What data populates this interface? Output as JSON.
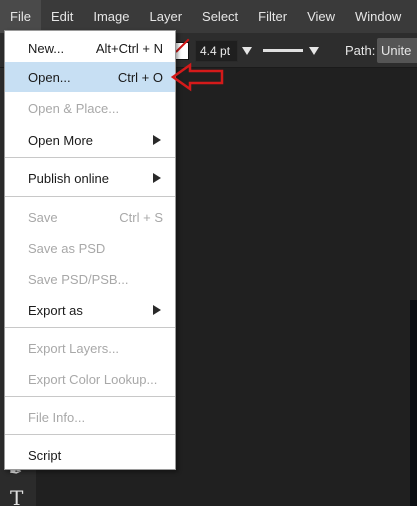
{
  "menubar": {
    "items": [
      "File",
      "Edit",
      "Image",
      "Layer",
      "Select",
      "Filter",
      "View",
      "Window"
    ]
  },
  "options": {
    "stroke_size": "4.4 pt",
    "path_label": "Path:",
    "path_value": "Unite"
  },
  "file_menu": {
    "new_label": "New...",
    "new_shortcut": "Alt+Ctrl + N",
    "open_label": "Open...",
    "open_shortcut": "Ctrl + O",
    "open_place_label": "Open & Place...",
    "open_more_label": "Open More",
    "publish_label": "Publish online",
    "save_label": "Save",
    "save_shortcut": "Ctrl + S",
    "save_psd_label": "Save as PSD",
    "save_psb_label": "Save PSD/PSB...",
    "export_as_label": "Export as",
    "export_layers_label": "Export Layers...",
    "export_lut_label": "Export Color Lookup...",
    "file_info_label": "File Info...",
    "script_label": "Script"
  },
  "colors": {
    "menubar_bg": "#3a3a3a",
    "menu_bg": "#ffffff",
    "highlight": "#c7dff3",
    "annotation": "#d41a1a"
  }
}
